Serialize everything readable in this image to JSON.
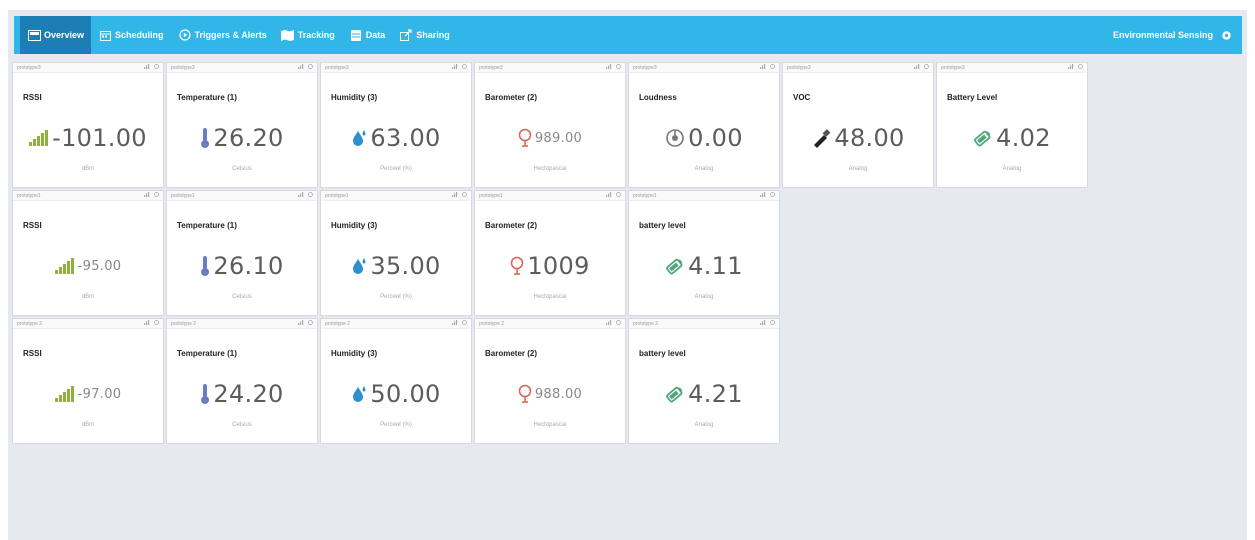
{
  "nav": {
    "tabs": [
      {
        "label": "Overview",
        "icon": "dashboard-icon",
        "active": true
      },
      {
        "label": "Scheduling",
        "icon": "calendar-icon",
        "active": false
      },
      {
        "label": "Triggers & Alerts",
        "icon": "play-circle-icon",
        "active": false
      },
      {
        "label": "Tracking",
        "icon": "map-icon",
        "active": false
      },
      {
        "label": "Data",
        "icon": "database-icon",
        "active": false
      },
      {
        "label": "Sharing",
        "icon": "share-icon",
        "active": false
      }
    ],
    "app_title": "Environmental Sensing",
    "settings_icon": "gear-icon"
  },
  "colors": {
    "navbar": "#31b6e7",
    "navbar_active": "#1d7db5",
    "signal": "#8db33c",
    "thermometer": "#6b7fc0",
    "drop": "#2f8fd0",
    "barometer": "#d9655f",
    "battery": "#4ea77a"
  },
  "rows": [
    {
      "cards": [
        {
          "device": "prototype3",
          "title": "RSSI",
          "value": "-101.00",
          "unit": "dBm",
          "icon": "signal-icon"
        },
        {
          "device": "prototype3",
          "title": "Temperature (1)",
          "value": "26.20",
          "unit": "Celsius",
          "icon": "thermometer-icon"
        },
        {
          "device": "prototype3",
          "title": "Humidity (3)",
          "value": "63.00",
          "unit": "Percent (%)",
          "icon": "water-drop-icon"
        },
        {
          "device": "prototype3",
          "title": "Barometer (2)",
          "value": "989.00",
          "unit": "Hectopascal",
          "icon": "barometer-icon"
        },
        {
          "device": "prototype3",
          "title": "Loudness",
          "value": "0.00",
          "unit": "Analog",
          "icon": "loudness-icon"
        },
        {
          "device": "prototype3",
          "title": "VOC",
          "value": "48.00",
          "unit": "Analog",
          "icon": "voc-icon"
        },
        {
          "device": "prototype3",
          "title": "Battery Level",
          "value": "4.02",
          "unit": "Analog",
          "icon": "battery-icon"
        }
      ]
    },
    {
      "cards": [
        {
          "device": "prototype1",
          "title": "RSSI",
          "value": "-95.00",
          "unit": "dBm",
          "icon": "signal-icon"
        },
        {
          "device": "prototype1",
          "title": "Temperature (1)",
          "value": "26.10",
          "unit": "Celsius",
          "icon": "thermometer-icon"
        },
        {
          "device": "prototype1",
          "title": "Humidity (3)",
          "value": "35.00",
          "unit": "Percent (%)",
          "icon": "water-drop-icon"
        },
        {
          "device": "prototype1",
          "title": "Barometer (2)",
          "value": "1009",
          "unit": "Hectopascal",
          "icon": "barometer-icon"
        },
        {
          "device": "prototype1",
          "title": "battery level",
          "value": "4.11",
          "unit": "Analog",
          "icon": "battery-icon"
        }
      ]
    },
    {
      "cards": [
        {
          "device": "prototype 2",
          "title": "RSSI",
          "value": "-97.00",
          "unit": "dBm",
          "icon": "signal-icon"
        },
        {
          "device": "prototype 2",
          "title": "Temperature (1)",
          "value": "24.20",
          "unit": "Celsius",
          "icon": "thermometer-icon"
        },
        {
          "device": "prototype 2",
          "title": "Humidity (3)",
          "value": "50.00",
          "unit": "Percent (%)",
          "icon": "water-drop-icon"
        },
        {
          "device": "prototype 2",
          "title": "Barometer (2)",
          "value": "988.00",
          "unit": "Hectopascal",
          "icon": "barometer-icon"
        },
        {
          "device": "prototype 2",
          "title": "battery level",
          "value": "4.21",
          "unit": "Analog",
          "icon": "battery-icon"
        }
      ]
    }
  ]
}
